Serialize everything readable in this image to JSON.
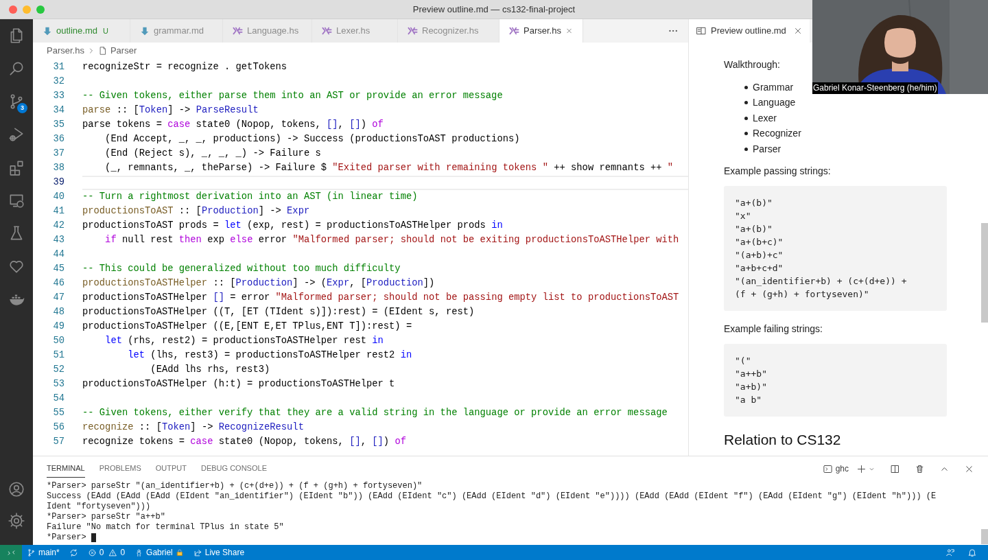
{
  "window": {
    "title": "Preview outline.md — cs132-final-project"
  },
  "activity_bar": {
    "items": [
      {
        "kind": "files"
      },
      {
        "kind": "search"
      },
      {
        "kind": "source-control",
        "badge": "3"
      },
      {
        "kind": "run-debug"
      },
      {
        "kind": "extensions"
      },
      {
        "kind": "remote"
      },
      {
        "kind": "testing"
      },
      {
        "kind": "heart"
      },
      {
        "kind": "docker"
      }
    ],
    "bottom": [
      {
        "kind": "account"
      },
      {
        "kind": "settings"
      }
    ]
  },
  "editor_tabs": [
    {
      "label": "outline.md",
      "kind": "markdown",
      "git_status": "U",
      "selected": false
    },
    {
      "label": "grammar.md",
      "kind": "markdown",
      "selected": false
    },
    {
      "label": "Language.hs",
      "kind": "haskell",
      "selected": false
    },
    {
      "label": "Lexer.hs",
      "kind": "haskell",
      "selected": false
    },
    {
      "label": "Recognizer.hs",
      "kind": "haskell",
      "selected": false
    },
    {
      "label": "Parser.hs",
      "kind": "haskell",
      "selected": true
    }
  ],
  "breadcrumb": [
    "Parser.hs",
    "Parser"
  ],
  "code_lines": [
    {
      "number": "31",
      "current": false,
      "tokens": [
        {
          "text": "recognizeStr = recognize . getTokens",
          "kind": "plain"
        }
      ]
    },
    {
      "number": "32",
      "current": false
    },
    {
      "number": "33",
      "current": false,
      "tokens": [
        {
          "text": "-- Given tokens, either parse them into an AST or provide an error message",
          "kind": "comment"
        }
      ]
    },
    {
      "number": "34",
      "current": false,
      "tokens": [
        {
          "text": "parse",
          "kind": "function"
        },
        {
          "text": " :: [",
          "kind": "plain"
        },
        {
          "text": "Token",
          "kind": "type"
        },
        {
          "text": "] -> ",
          "kind": "plain"
        },
        {
          "text": "ParseResult",
          "kind": "type"
        }
      ]
    },
    {
      "number": "35",
      "current": false,
      "tokens": [
        {
          "text": "parse tokens = ",
          "kind": "plain"
        },
        {
          "text": "case",
          "kind": "control"
        },
        {
          "text": " state0 (Nopop, tokens, ",
          "kind": "plain"
        },
        {
          "text": "[]",
          "kind": "type"
        },
        {
          "text": ", ",
          "kind": "plain"
        },
        {
          "text": "[]",
          "kind": "type"
        },
        {
          "text": ") ",
          "kind": "plain"
        },
        {
          "text": "of",
          "kind": "control"
        }
      ]
    },
    {
      "number": "36",
      "current": false,
      "tokens": [
        {
          "text": "    (End Accept, _, _, productions) -> Success (productionsToAST productions)",
          "kind": "plain"
        }
      ]
    },
    {
      "number": "37",
      "current": false,
      "tokens": [
        {
          "text": "    (End (Reject s), _, _, _) -> Failure s",
          "kind": "plain"
        }
      ]
    },
    {
      "number": "38",
      "current": false,
      "tokens": [
        {
          "text": "    (_, remnants, _, theParse) -> Failure $ ",
          "kind": "plain"
        },
        {
          "text": "\"Exited parser with remaining tokens \"",
          "kind": "string"
        },
        {
          "text": " ++ show remnants ++ ",
          "kind": "plain"
        },
        {
          "text": "\"",
          "kind": "string"
        }
      ]
    },
    {
      "number": "39",
      "current": true
    },
    {
      "number": "40",
      "current": false,
      "tokens": [
        {
          "text": "-- Turn a rightmost derivation into an AST (in linear time)",
          "kind": "comment"
        }
      ]
    },
    {
      "number": "41",
      "current": false,
      "tokens": [
        {
          "text": "productionsToAST",
          "kind": "function"
        },
        {
          "text": " :: [",
          "kind": "plain"
        },
        {
          "text": "Production",
          "kind": "type"
        },
        {
          "text": "] -> ",
          "kind": "plain"
        },
        {
          "text": "Expr",
          "kind": "type"
        }
      ]
    },
    {
      "number": "42",
      "current": false,
      "tokens": [
        {
          "text": "productionsToAST prods = ",
          "kind": "plain"
        },
        {
          "text": "let",
          "kind": "keyword"
        },
        {
          "text": " (exp, rest) = productionsToASTHelper prods ",
          "kind": "plain"
        },
        {
          "text": "in",
          "kind": "keyword"
        }
      ]
    },
    {
      "number": "43",
      "current": false,
      "tokens": [
        {
          "text": "    if",
          "kind": "control"
        },
        {
          "text": " null rest ",
          "kind": "plain"
        },
        {
          "text": "then",
          "kind": "control"
        },
        {
          "text": " exp ",
          "kind": "plain"
        },
        {
          "text": "else",
          "kind": "control"
        },
        {
          "text": " error ",
          "kind": "plain"
        },
        {
          "text": "\"Malformed parser; should not be exiting productionsToASTHelper with",
          "kind": "string"
        }
      ]
    },
    {
      "number": "44",
      "current": false
    },
    {
      "number": "45",
      "current": false,
      "tokens": [
        {
          "text": "-- This could be generalized without too much difficulty",
          "kind": "comment"
        }
      ]
    },
    {
      "number": "46",
      "current": false,
      "tokens": [
        {
          "text": "productionsToASTHelper",
          "kind": "function"
        },
        {
          "text": " :: [",
          "kind": "plain"
        },
        {
          "text": "Production",
          "kind": "type"
        },
        {
          "text": "] -> (",
          "kind": "plain"
        },
        {
          "text": "Expr",
          "kind": "type"
        },
        {
          "text": ", [",
          "kind": "plain"
        },
        {
          "text": "Production",
          "kind": "type"
        },
        {
          "text": "])",
          "kind": "plain"
        }
      ]
    },
    {
      "number": "47",
      "current": false,
      "tokens": [
        {
          "text": "productionsToASTHelper ",
          "kind": "plain"
        },
        {
          "text": "[]",
          "kind": "type"
        },
        {
          "text": " = error ",
          "kind": "plain"
        },
        {
          "text": "\"Malformed parser; should not be passing empty list to productionsToAST",
          "kind": "string"
        }
      ]
    },
    {
      "number": "48",
      "current": false,
      "tokens": [
        {
          "text": "productionsToASTHelper ((T, [ET (TIdent s)]):rest) = (EIdent s, rest)",
          "kind": "plain"
        }
      ]
    },
    {
      "number": "49",
      "current": false,
      "tokens": [
        {
          "text": "productionsToASTHelper ((E,[ENT E,ET TPlus,ENT T]):rest) =",
          "kind": "plain"
        }
      ]
    },
    {
      "number": "50",
      "current": false,
      "tokens": [
        {
          "text": "    let",
          "kind": "keyword"
        },
        {
          "text": " (rhs, rest2) = productionsToASTHelper rest ",
          "kind": "plain"
        },
        {
          "text": "in",
          "kind": "keyword"
        }
      ]
    },
    {
      "number": "51",
      "current": false,
      "tokens": [
        {
          "text": "        let",
          "kind": "keyword"
        },
        {
          "text": " (lhs, rest3) = productionsToASTHelper rest2 ",
          "kind": "plain"
        },
        {
          "text": "in",
          "kind": "keyword"
        }
      ]
    },
    {
      "number": "52",
      "current": false,
      "tokens": [
        {
          "text": "            (EAdd lhs rhs, rest3)",
          "kind": "plain"
        }
      ]
    },
    {
      "number": "53",
      "current": false,
      "tokens": [
        {
          "text": "productionsToASTHelper (h:t) = productionsToASTHelper t",
          "kind": "plain"
        }
      ]
    },
    {
      "number": "54",
      "current": false
    },
    {
      "number": "55",
      "current": false,
      "tokens": [
        {
          "text": "-- Given tokens, either verify that they are a valid string in the language or provide an error message",
          "kind": "comment"
        }
      ]
    },
    {
      "number": "56",
      "current": false,
      "tokens": [
        {
          "text": "recognize",
          "kind": "function"
        },
        {
          "text": " :: [",
          "kind": "plain"
        },
        {
          "text": "Token",
          "kind": "type"
        },
        {
          "text": "] -> ",
          "kind": "plain"
        },
        {
          "text": "RecognizeResult",
          "kind": "type"
        }
      ]
    },
    {
      "number": "57",
      "current": false,
      "tokens": [
        {
          "text": "recognize tokens = ",
          "kind": "plain"
        },
        {
          "text": "case",
          "kind": "control"
        },
        {
          "text": " state0 (Nopop, tokens, ",
          "kind": "plain"
        },
        {
          "text": "[]",
          "kind": "type"
        },
        {
          "text": ", ",
          "kind": "plain"
        },
        {
          "text": "[]",
          "kind": "type"
        },
        {
          "text": ") ",
          "kind": "plain"
        },
        {
          "text": "of",
          "kind": "control"
        }
      ]
    }
  ],
  "preview": {
    "tab": "Preview outline.md",
    "blocks": [
      {
        "kind": "paragraph",
        "text": "Walkthrough:"
      },
      {
        "kind": "list",
        "items": [
          "Grammar",
          "Language",
          "Lexer",
          "Recognizer",
          "Parser"
        ]
      },
      {
        "kind": "paragraph",
        "text": "Example passing strings:"
      },
      {
        "kind": "code",
        "lines": [
          "\"a+(b)\"",
          "\"x\"",
          "\"a+(b)\"",
          "\"a+(b+c)\"",
          "\"(a+b)+c\"",
          "\"a+b+c+d\"",
          "\"(an_identifier+b) + (c+(d+e)) +",
          "(f + (g+h) + fortyseven)\""
        ]
      },
      {
        "kind": "paragraph",
        "text": "Example failing strings:"
      },
      {
        "kind": "code",
        "lines": [
          "\"(\"",
          "\"a++b\"",
          "\"a+b)\"",
          "\"a b\""
        ]
      },
      {
        "kind": "heading",
        "text": "Relation to CS132"
      }
    ]
  },
  "video": {
    "name": "Gabriel Konar-Steenberg (he/him)"
  },
  "panel": {
    "tabs": [
      {
        "label": "TERMINAL",
        "selected": true
      },
      {
        "label": "PROBLEMS",
        "selected": false
      },
      {
        "label": "OUTPUT",
        "selected": false
      },
      {
        "label": "DEBUG CONSOLE",
        "selected": false
      }
    ],
    "shell": "ghc",
    "lines": [
      "*Parser> parseStr \"(an_identifier+b) + (c+(d+e)) + (f + (g+h) + fortyseven)\"",
      "Success (EAdd (EAdd (EAdd (EIdent \"an_identifier\") (EIdent \"b\")) (EAdd (EIdent \"c\") (EAdd (EIdent \"d\") (EIdent \"e\")))) (EAdd (EAdd (EIdent \"f\") (EAdd (EIdent \"g\") (EIdent \"h\"))) (E",
      "Ident \"fortyseven\")))",
      "*Parser> parseStr \"a++b\"",
      "Failure \"No match for terminal TPlus in state 5\"",
      "*Parser> "
    ]
  },
  "status_bar": {
    "branch": "main*",
    "errors": "0",
    "warnings": "0",
    "user": "Gabriel",
    "live_share": "Live Share"
  }
}
